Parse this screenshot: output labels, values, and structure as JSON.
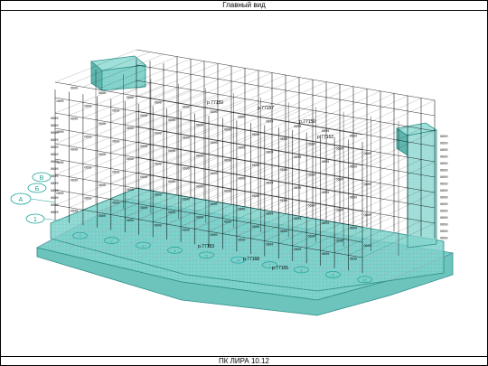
{
  "window": {
    "title": "Главный вид",
    "status": "ПК ЛИРА 10.12"
  },
  "axes": {
    "numbered": [
      "1",
      "2",
      "3",
      "4",
      "5",
      "6",
      "7",
      "8",
      "9",
      "10"
    ],
    "lettered": [
      "А",
      "Б",
      "В",
      "1"
    ]
  },
  "labels": {
    "sample_top": [
      "р.77159",
      "р.77157",
      "р.77150",
      "р.77152"
    ],
    "sample_bottom": [
      "р.77153",
      "р.77168",
      "р.77155"
    ],
    "node_value": "0699"
  },
  "colors": {
    "slab_fill": "#7fd3cc",
    "slab_edge": "#2f8f89",
    "grid_line": "#c59ad6",
    "wire": "#000000",
    "axis_marker": "#1aa29a"
  }
}
